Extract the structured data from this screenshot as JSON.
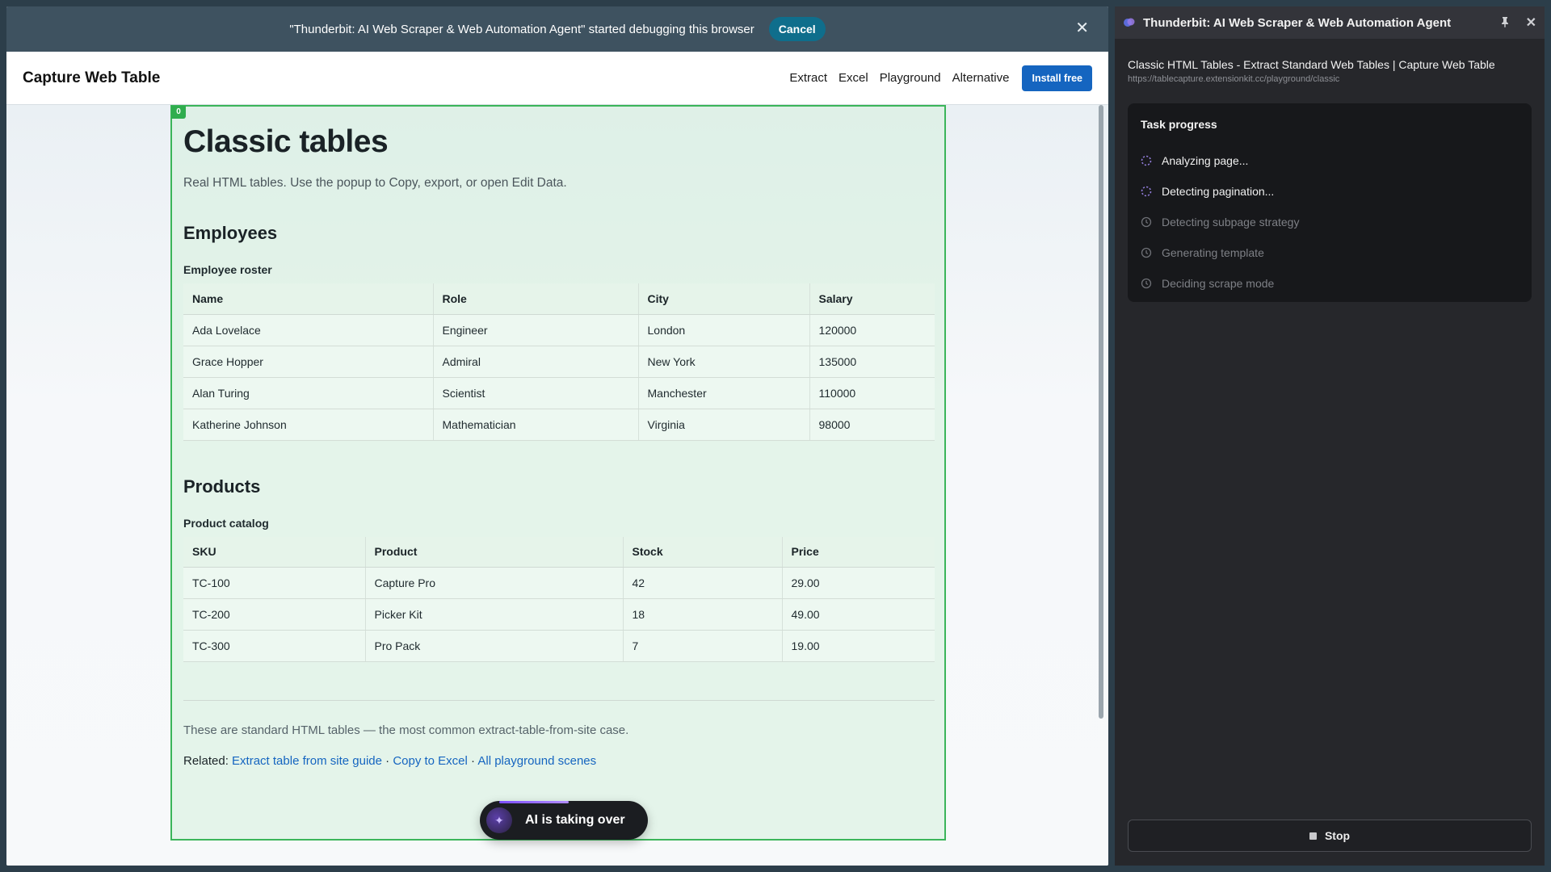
{
  "debug_bar": {
    "message": "\"Thunderbit: AI Web Scraper & Web Automation Agent\" started debugging this browser",
    "cancel_label": "Cancel",
    "close_symbol": "✕"
  },
  "site": {
    "brand": "Capture Web Table",
    "nav": [
      "Extract",
      "Excel",
      "Playground",
      "Alternative"
    ],
    "install_label": "Install free"
  },
  "overlay": {
    "badge": "0"
  },
  "page": {
    "title": "Classic tables",
    "lead": "Real HTML tables. Use the popup to Copy, export, or open Edit Data.",
    "employees": {
      "heading": "Employees",
      "caption": "Employee roster",
      "columns": [
        "Name",
        "Role",
        "City",
        "Salary"
      ],
      "rows": [
        [
          "Ada Lovelace",
          "Engineer",
          "London",
          "120000"
        ],
        [
          "Grace Hopper",
          "Admiral",
          "New York",
          "135000"
        ],
        [
          "Alan Turing",
          "Scientist",
          "Manchester",
          "110000"
        ],
        [
          "Katherine Johnson",
          "Mathematician",
          "Virginia",
          "98000"
        ]
      ]
    },
    "products": {
      "heading": "Products",
      "caption": "Product catalog",
      "columns": [
        "SKU",
        "Product",
        "Stock",
        "Price"
      ],
      "rows": [
        [
          "TC-100",
          "Capture Pro",
          "42",
          "29.00"
        ],
        [
          "TC-200",
          "Picker Kit",
          "18",
          "49.00"
        ],
        [
          "TC-300",
          "Pro Pack",
          "7",
          "19.00"
        ]
      ]
    },
    "footer_note": "These are standard HTML tables — the most common extract-table-from-site case.",
    "related_label": "Related:",
    "related_links": [
      "Extract table from site guide",
      "Copy to Excel",
      "All playground scenes"
    ],
    "related_sep": "·"
  },
  "ai_pill": {
    "label": "AI is taking over"
  },
  "panel": {
    "title": "Thunderbit: AI Web Scraper & Web Automation Agent",
    "pin_symbol": "📌",
    "close_symbol": "✕",
    "page_title": "Classic HTML Tables - Extract Standard Web Tables | Capture Web Table",
    "page_url": "https://tablecapture.extensionkit.cc/playground/classic",
    "progress_heading": "Task progress",
    "steps": [
      {
        "label": "Analyzing page...",
        "state": "active"
      },
      {
        "label": "Detecting pagination...",
        "state": "active"
      },
      {
        "label": "Detecting subpage strategy",
        "state": "pending"
      },
      {
        "label": "Generating template",
        "state": "pending"
      },
      {
        "label": "Deciding scrape mode",
        "state": "pending"
      }
    ],
    "stop_label": "Stop"
  },
  "colors": {
    "accent": "#1565c0",
    "overlay_border": "#3bb55a",
    "panel_bg": "#26272b",
    "debug_bar": "#3e5260",
    "spinner": "#8f7bd6"
  }
}
